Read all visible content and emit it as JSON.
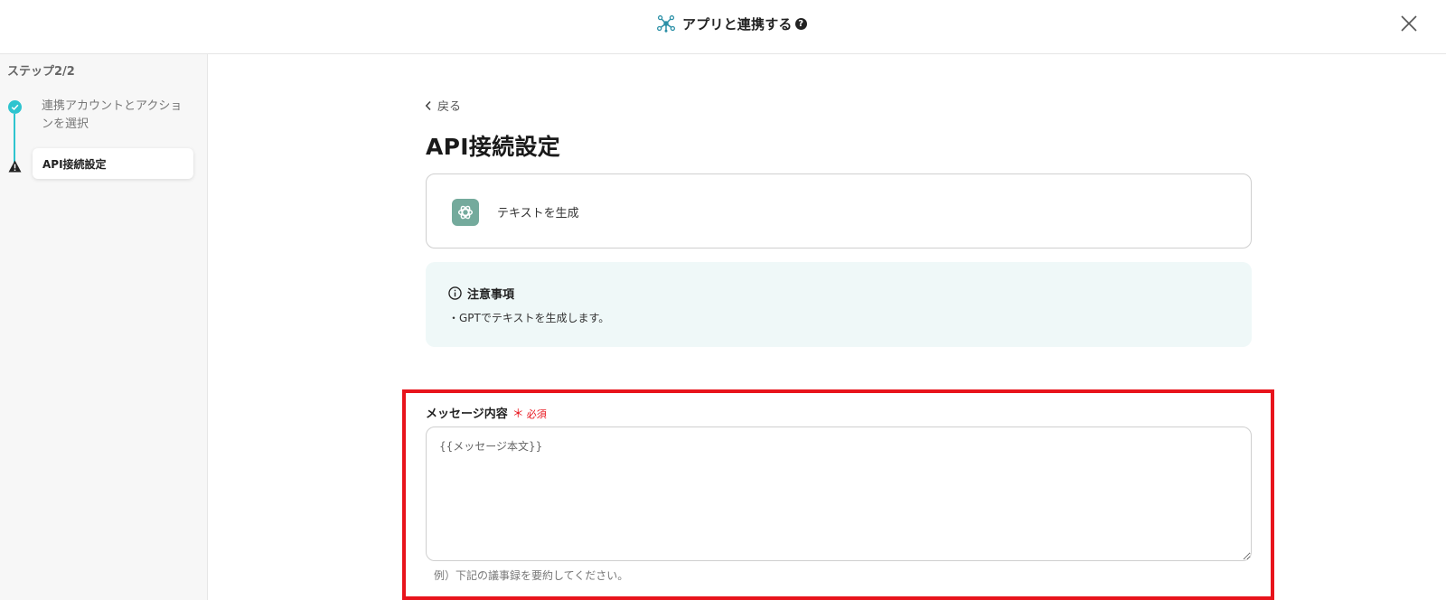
{
  "header": {
    "title": "アプリと連携する",
    "title_icon": "network-nodes-icon",
    "help_glyph": "?",
    "close_icon": "close-icon"
  },
  "sidebar": {
    "step_title": "ステップ2/2",
    "steps": [
      {
        "label": "連携アカウントとアクションを選択",
        "status": "completed",
        "icon": "check-circle-icon"
      },
      {
        "label": "API接続設定",
        "status": "warning",
        "icon": "warning-triangle-icon"
      }
    ],
    "accent_color": "#2ec4cf"
  },
  "main": {
    "back_label": "戻る",
    "page_title": "API接続設定",
    "action": {
      "label": "テキストを生成",
      "app_icon": "openai-icon"
    },
    "notice": {
      "heading": "注意事項",
      "body": "・GPTでテキストを生成します。"
    },
    "message_field": {
      "label": "メッセージ内容",
      "required_mark": "＊",
      "required_text": "必須",
      "value": "{{メッセージ本文}}",
      "hint": "例）下記の議事録を要約してください。"
    }
  },
  "colors": {
    "highlight_border": "#e8141c",
    "notice_background": "#eff8f8",
    "openai_green": "#74aa9c"
  }
}
